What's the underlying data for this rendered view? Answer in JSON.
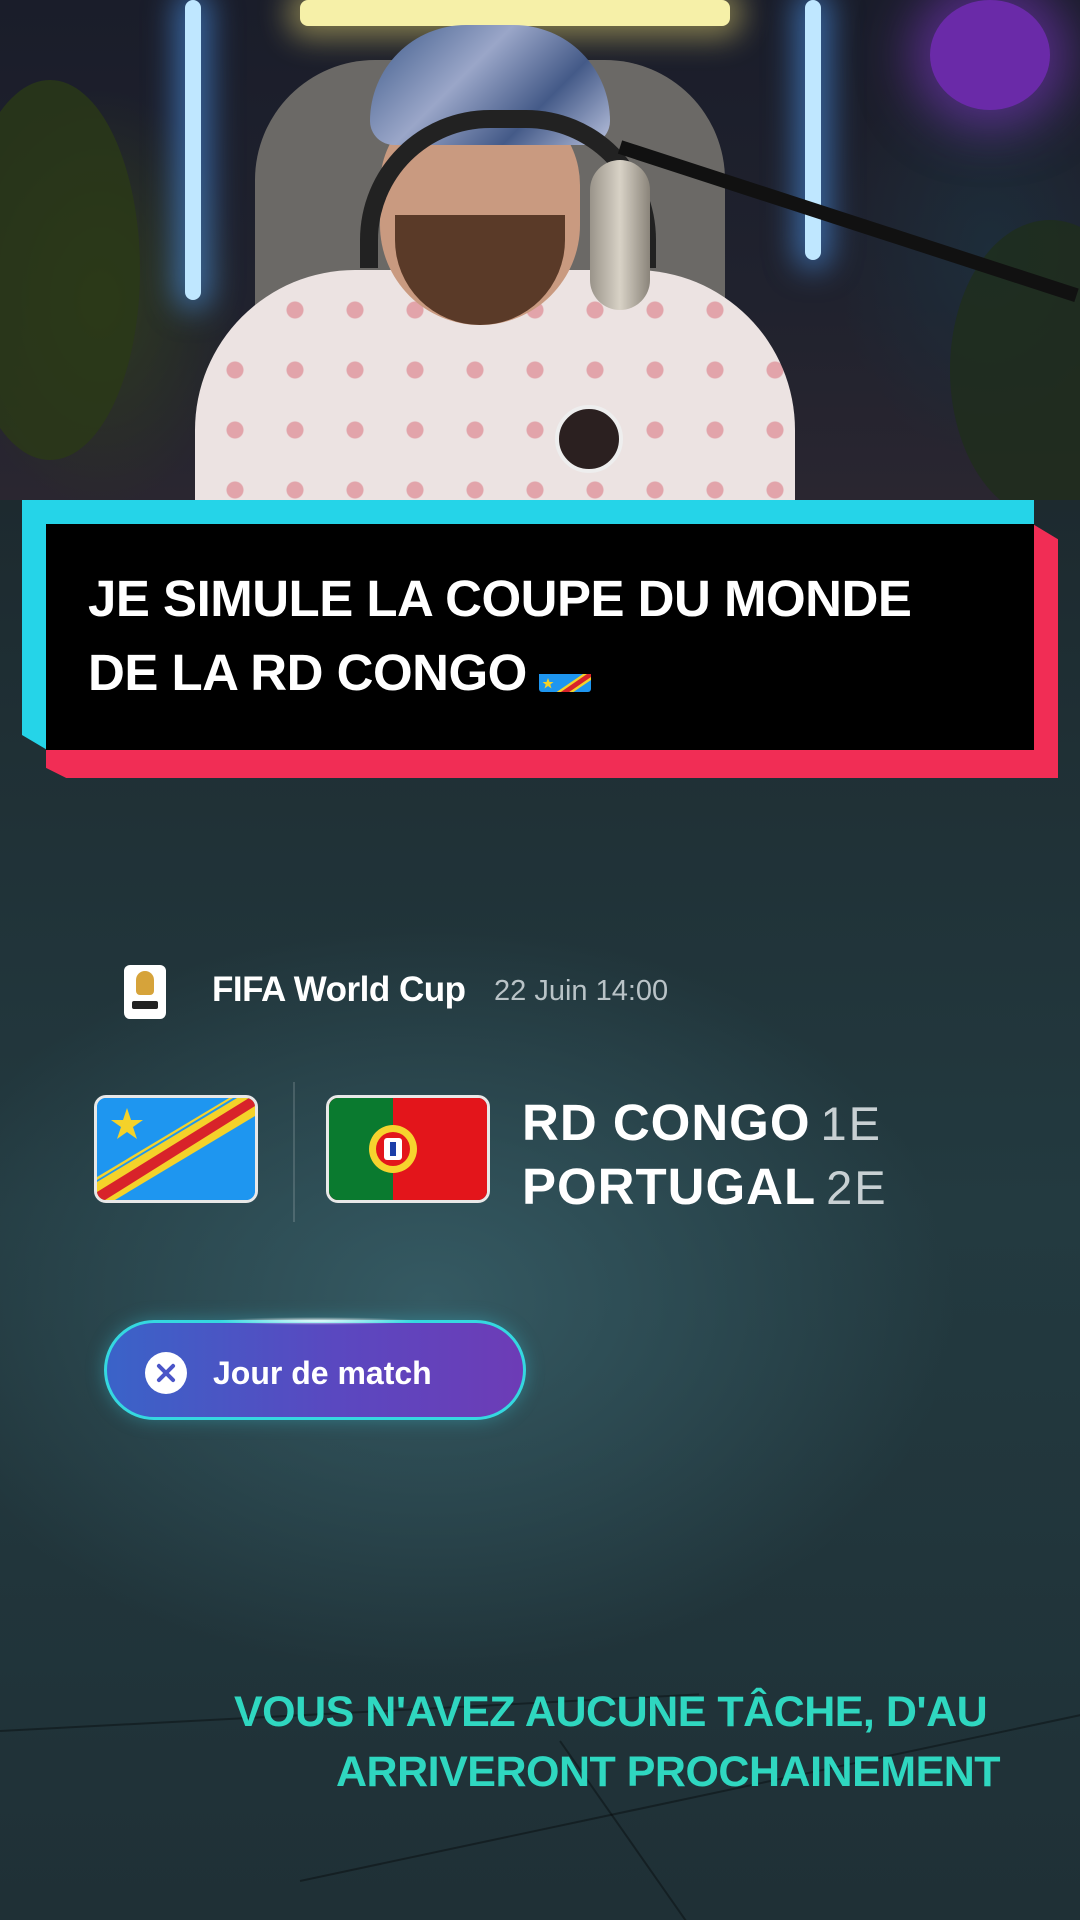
{
  "title": {
    "line1": "JE SIMULE LA COUPE DU MONDE",
    "line2": "DE LA RD CONGO",
    "flag_icon": "drc-flag-emoji"
  },
  "fixture": {
    "competition": "FIFA World Cup",
    "datetime": "22 Juin 14:00",
    "competition_icon": "fifa-world-cup-trophy-icon",
    "home": {
      "name": "RD CONGO",
      "rank": "1E",
      "flag_icon": "drc-flag"
    },
    "away": {
      "name": "PORTUGAL",
      "rank": "2E",
      "flag_icon": "portugal-flag"
    }
  },
  "match_button": {
    "label": "Jour de match",
    "icon": "x-button-icon"
  },
  "notice": {
    "line1": "VOUS N'AVEZ AUCUNE TÂCHE, D'AU",
    "line2": "ARRIVERONT PROCHAINEMENT"
  },
  "colors": {
    "banner_cyan": "#25d4e8",
    "banner_red": "#f12d55",
    "notice_teal": "#2fd7c0",
    "button_start": "#3a63c8",
    "button_end": "#6d3cb6"
  }
}
